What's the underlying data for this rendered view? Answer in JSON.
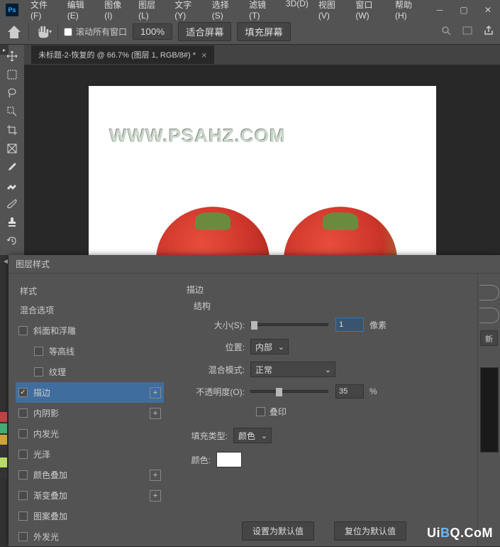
{
  "menu": {
    "file": "文件(F)",
    "edit": "编辑(E)",
    "image": "图像(I)",
    "layer": "图层(L)",
    "type": "文字(Y)",
    "select": "选择(S)",
    "filter": "滤镜(T)",
    "threeD": "3D(D)",
    "view": "视图(V)",
    "window": "窗口(W)",
    "help": "帮助(H)"
  },
  "options": {
    "scroll_all": "滚动所有窗口",
    "zoom": "100%",
    "fit": "适合屏幕",
    "fill": "填充屏幕"
  },
  "tab": {
    "title": "未标题-2-恢复的 @ 66.7% (图层 1, RGB/8#) *"
  },
  "canvas": {
    "watermark": "WWW.PSAHZ.COM"
  },
  "dialog": {
    "title": "图层样式",
    "styles_heading": "样式",
    "blend_options": "混合选项",
    "items": {
      "bevel": "斜面和浮雕",
      "contour": "等高线",
      "texture": "纹理",
      "stroke": "描边",
      "inner_shadow": "内阴影",
      "inner_glow": "内发光",
      "satin": "光泽",
      "color_overlay": "颜色叠加",
      "gradient_overlay": "渐变叠加",
      "pattern_overlay": "图案叠加",
      "outer_glow": "外发光"
    },
    "stroke_panel": {
      "title": "描边",
      "structure": "结构",
      "size_label": "大小(S):",
      "size_value": "1",
      "unit_px": "像素",
      "position_label": "位置:",
      "position_value": "内部",
      "blend_label": "混合模式:",
      "blend_value": "正常",
      "opacity_label": "不透明度(O):",
      "opacity_value": "35",
      "unit_pct": "%",
      "overprint": "叠印",
      "fill_type_label": "填充类型:",
      "fill_type_value": "颜色",
      "color_label": "颜色:",
      "set_default": "设置为默认值",
      "reset_default": "复位为默认值"
    },
    "right": {
      "new": "新"
    }
  },
  "watermark2": {
    "prefix": "Ui",
    "b": "B",
    "suffix": "Q.CoM"
  }
}
